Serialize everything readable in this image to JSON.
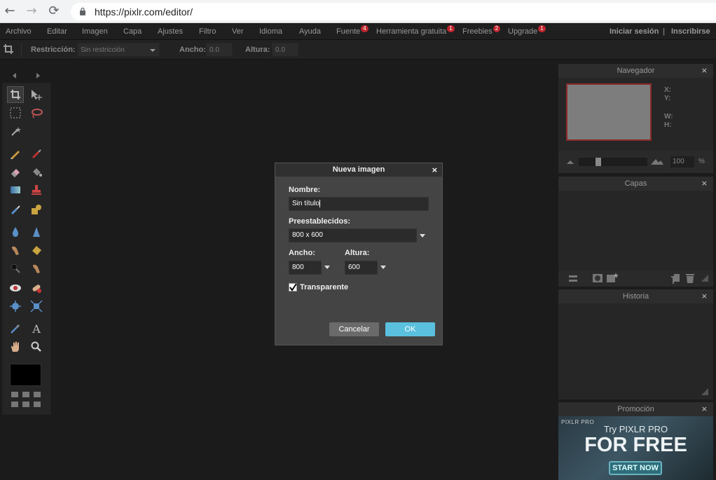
{
  "browser": {
    "url": "https://pixlr.com/editor/",
    "back_icon": "←",
    "forward_icon": "→",
    "reload_icon": "⟳"
  },
  "menubar": {
    "items": [
      {
        "label": "Archivo"
      },
      {
        "label": "Editar"
      },
      {
        "label": "Imagen"
      },
      {
        "label": "Capa"
      },
      {
        "label": "Ajustes"
      },
      {
        "label": "Filtro"
      },
      {
        "label": "Ver"
      },
      {
        "label": "Idioma"
      },
      {
        "label": "Ayuda"
      },
      {
        "label": "Fuente",
        "badge": "4"
      },
      {
        "label": "Herramienta gratuita",
        "badge": "1"
      },
      {
        "label": "Freebies",
        "badge": "2"
      },
      {
        "label": "Upgrade",
        "badge": "1"
      }
    ],
    "login": "Iniciar sesión",
    "separator": "|",
    "signup": "Inscribirse"
  },
  "options": {
    "restriccion_label": "Restricción:",
    "restriccion_value": "Sin restricción",
    "ancho_label": "Ancho:",
    "ancho_value": "0.0",
    "altura_label": "Altura:",
    "altura_value": "0.0"
  },
  "navigator": {
    "title": "Navegador",
    "close": "×",
    "x_label": "X:",
    "y_label": "Y:",
    "w_label": "W:",
    "h_label": "H:",
    "zoom": "100",
    "zoom_unit": "%"
  },
  "layers": {
    "title": "Capas",
    "close": "×"
  },
  "history": {
    "title": "Historia",
    "close": "×"
  },
  "promo": {
    "title": "Promoción",
    "close": "×",
    "brand": "PIXLR PRO",
    "line1": "Try PIXLR PRO",
    "line2": "FOR FREE",
    "cta": "START NOW"
  },
  "dialog": {
    "title": "Nueva imagen",
    "close": "×",
    "name_label": "Nombre:",
    "name_value": "Sin título",
    "presets_label": "Preestablecidos:",
    "presets_value": "800 x 600",
    "width_label": "Ancho:",
    "width_value": "800",
    "height_label": "Altura:",
    "height_value": "600",
    "transparent_label": "Transparente",
    "transparent_checked": true,
    "cancel_label": "Cancelar",
    "ok_label": "OK"
  },
  "colors": {
    "accent": "#5bc0de",
    "badge": "#c0262d"
  }
}
